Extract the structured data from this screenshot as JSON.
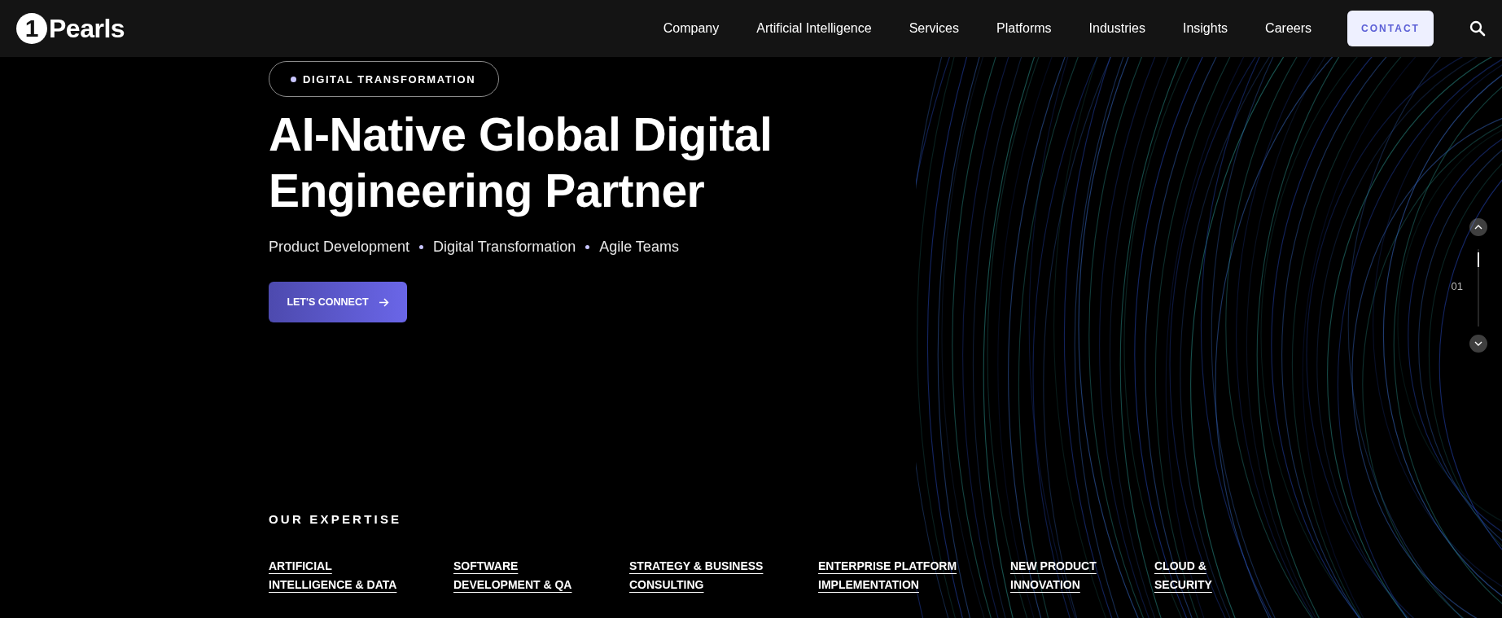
{
  "header": {
    "logo": {
      "mark": "1",
      "word": "Pearls"
    },
    "nav": [
      {
        "label": "Company"
      },
      {
        "label": "Artificial Intelligence"
      },
      {
        "label": "Services"
      },
      {
        "label": "Platforms"
      },
      {
        "label": "Industries"
      },
      {
        "label": "Insights"
      },
      {
        "label": "Careers"
      }
    ],
    "contact_button": "CONTACT"
  },
  "hero": {
    "badge": "DIGITAL TRANSFORMATION",
    "title": "AI-Native Global Digital Engineering Partner",
    "subtitle_items": [
      "Product Development",
      "Digital Transformation",
      "Agile Teams"
    ],
    "cta": "LET'S CONNECT"
  },
  "slide_indicator": {
    "number": "01"
  },
  "expertise": {
    "heading": "OUR EXPERTISE",
    "links": [
      "ARTIFICIAL\nINTELLIGENCE & DATA",
      "SOFTWARE\nDEVELOPMENT & QA",
      "STRATEGY & BUSINESS\nCONSULTING",
      "ENTERPRISE PLATFORM\nIMPLEMENTATION",
      "NEW PRODUCT\nINNOVATION",
      "CLOUD &\nSECURITY"
    ]
  }
}
